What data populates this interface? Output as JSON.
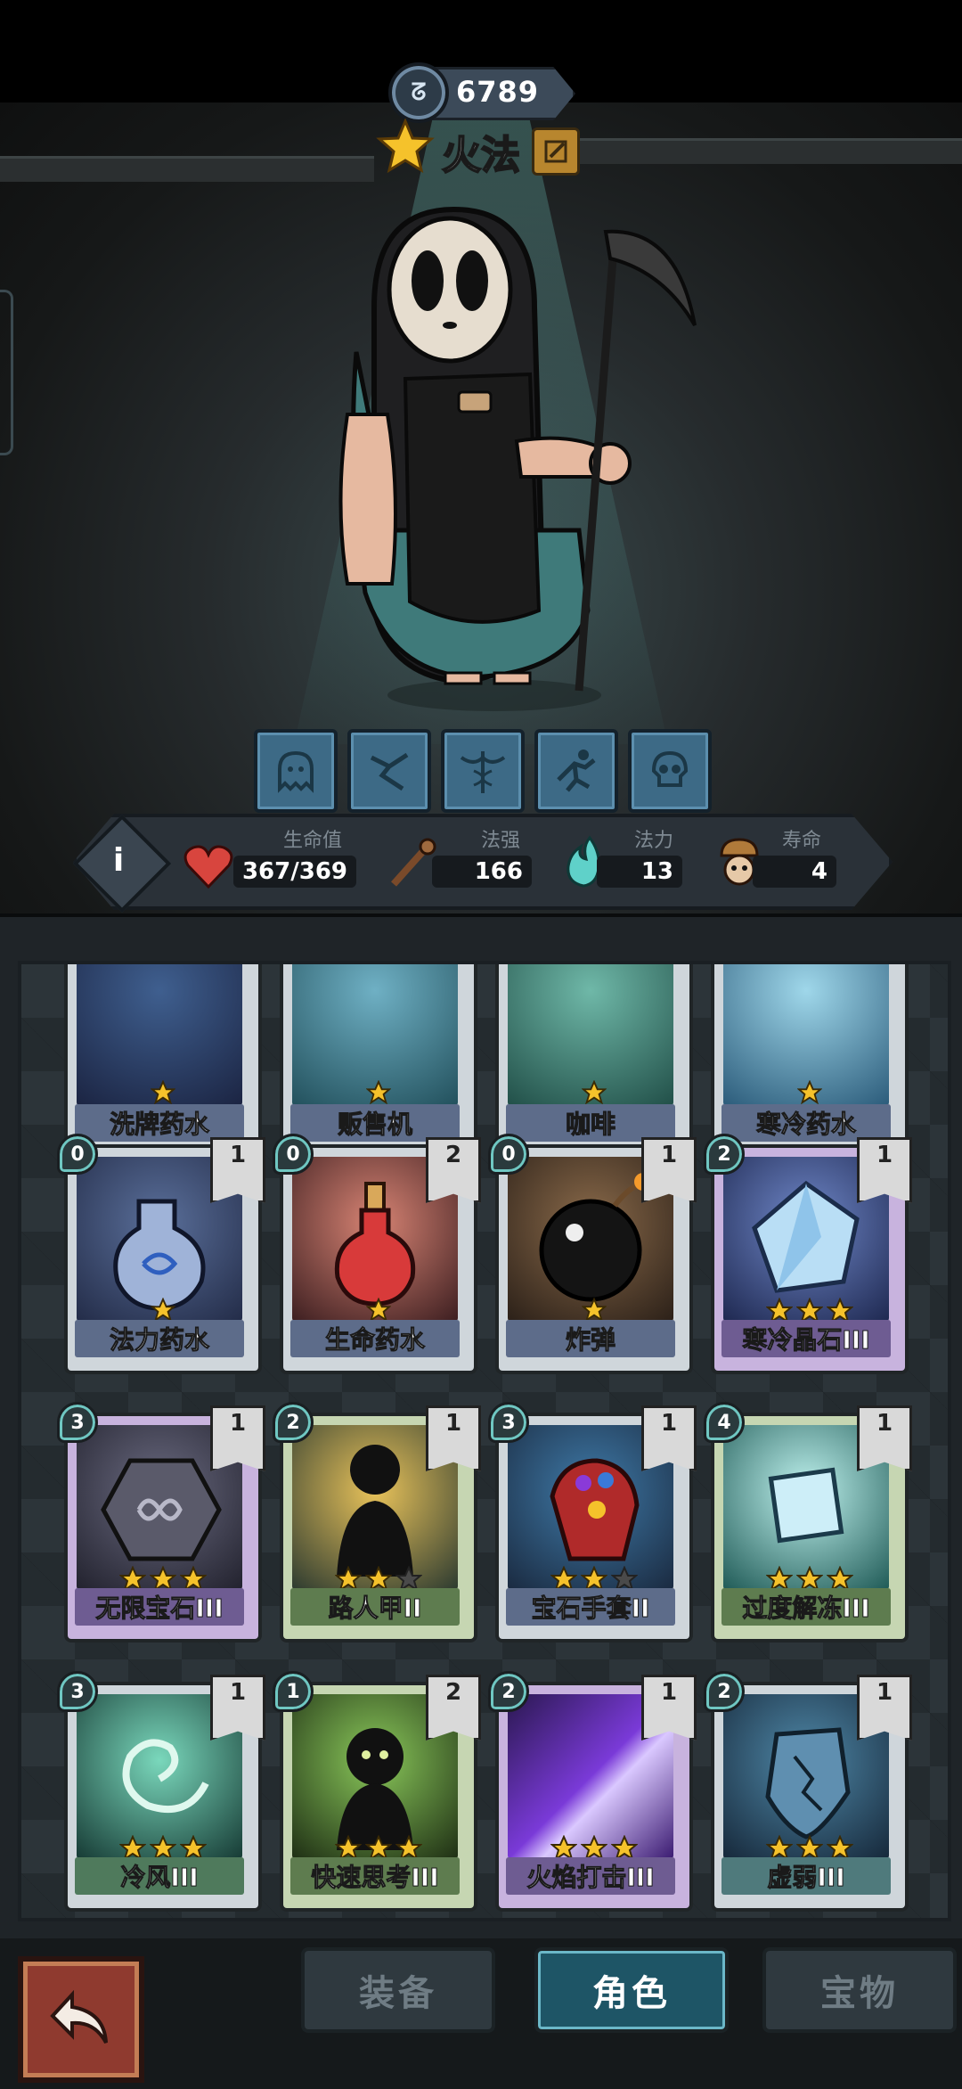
{
  "header": {
    "currency_value": "6789",
    "character_name": "火法"
  },
  "stats": {
    "hp_label": "生命值",
    "hp_value": "367/369",
    "power_label": "法强",
    "power_value": "166",
    "mana_label": "法力",
    "mana_value": "13",
    "life_label": "寿命",
    "life_value": "4",
    "info_letter": "i"
  },
  "skills": [
    "ghost-skill-icon",
    "crack-skill-icon",
    "caduceus-skill-icon",
    "leap-skill-icon",
    "skull-skill-icon"
  ],
  "cards": {
    "row0": [
      {
        "name": "洗牌药水",
        "stars": 1
      },
      {
        "name": "贩售机",
        "stars": 1
      },
      {
        "name": "咖啡",
        "stars": 1
      },
      {
        "name": "寒冷药水",
        "stars": 1
      }
    ],
    "row1": [
      {
        "name": "法力药水",
        "cost": "0",
        "level": "1",
        "stars": 1
      },
      {
        "name": "生命药水",
        "cost": "0",
        "level": "2",
        "stars": 1
      },
      {
        "name": "炸弹",
        "cost": "0",
        "level": "1",
        "stars": 1
      },
      {
        "name": "寒冷晶石III",
        "cost": "2",
        "level": "1",
        "stars": 3
      }
    ],
    "row2": [
      {
        "name": "无限宝石III",
        "cost": "3",
        "level": "1",
        "stars": 3
      },
      {
        "name": "路人甲II",
        "cost": "2",
        "level": "1",
        "stars": 2
      },
      {
        "name": "宝石手套II",
        "cost": "3",
        "level": "1",
        "stars": 2
      },
      {
        "name": "过度解冻III",
        "cost": "4",
        "level": "1",
        "stars": 3
      }
    ],
    "row3": [
      {
        "name": "冷风III",
        "cost": "3",
        "level": "1",
        "stars": 3
      },
      {
        "name": "快速思考III",
        "cost": "1",
        "level": "2",
        "stars": 3
      },
      {
        "name": "火焰打击III",
        "cost": "2",
        "level": "1",
        "stars": 3
      },
      {
        "name": "虚弱III",
        "cost": "2",
        "level": "1",
        "stars": 3
      }
    ]
  },
  "tabs": {
    "equipment": "装备",
    "character": "角色",
    "treasure": "宝物"
  },
  "colors": {
    "accent_teal": "#6bb7c8",
    "star_gold": "#f5c22b",
    "back_button": "#8f3a2f"
  }
}
